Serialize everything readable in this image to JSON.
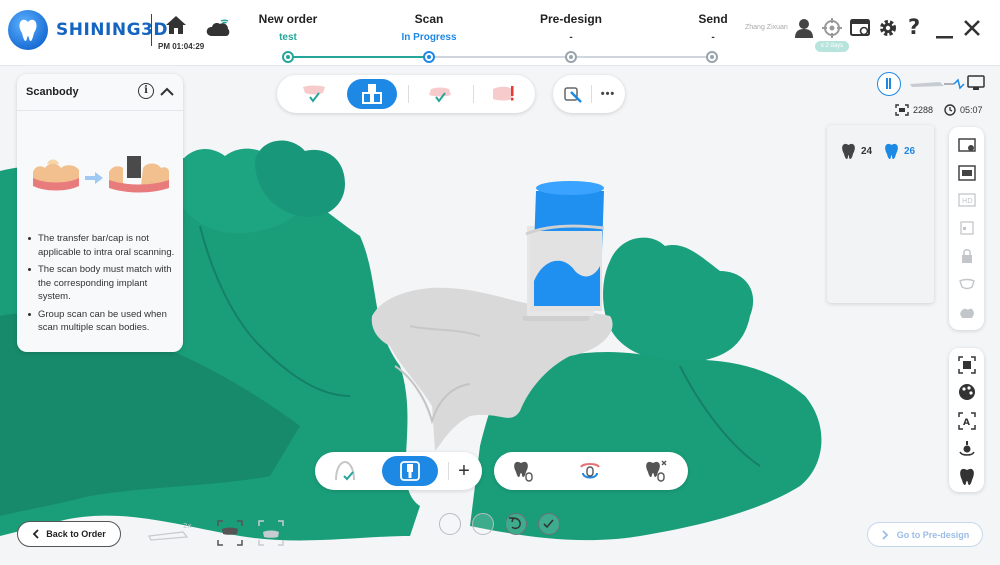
{
  "app": {
    "brand": "SHINING3D",
    "time": "PM 01:04:29",
    "user_name": "Zhang Zixuan",
    "tag": "x 2 days",
    "colors": {
      "brand": "#1565c0",
      "accent": "#1e88e5",
      "done": "#26a69a",
      "model_green": "#1a9e7a",
      "model_gray": "#d9d9d9"
    }
  },
  "workflow": {
    "steps": [
      {
        "title": "New order",
        "sub": "test",
        "state": "done"
      },
      {
        "title": "Scan",
        "sub": "In Progress",
        "state": "active"
      },
      {
        "title": "Pre-design",
        "sub": "-",
        "state": "pending"
      },
      {
        "title": "Send",
        "sub": "-",
        "state": "pending"
      }
    ]
  },
  "scanbody": {
    "title": "Scanbody",
    "info_icon": "i",
    "tips": [
      "The transfer bar/cap is not applicable to intra oral scanning.",
      "The scan body must match with the corresponding implant system.",
      "Group scan can be used when scan multiple scan bodies."
    ]
  },
  "stats": {
    "points": "2288",
    "duration": "05:07"
  },
  "teeth": [
    {
      "number": "24",
      "selected": false
    },
    {
      "number": "26",
      "selected": true
    }
  ],
  "buttons": {
    "back": "Back to Order",
    "next": "Go to Pre-design",
    "more": "•••",
    "add": "+"
  },
  "icons": {
    "home": "home-icon",
    "cloud": "cloud-wifi-icon",
    "user": "user-icon",
    "target": "crosshair-icon",
    "window": "window-settings-icon",
    "settings": "gear-icon",
    "help": "help-icon",
    "minimize": "minimize-icon",
    "close": "close-icon"
  }
}
